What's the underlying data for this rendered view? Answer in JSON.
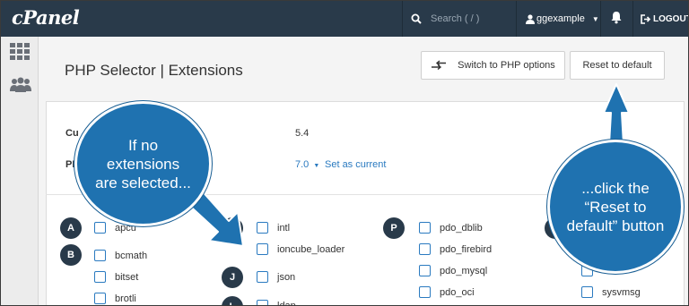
{
  "topbar": {
    "logo": "cPanel",
    "search_placeholder": "Search ( / )",
    "username": "ggexample",
    "logout": "LOGOUT"
  },
  "page": {
    "title": "PHP Selector | Extensions",
    "switch_button": "Switch to PHP options",
    "reset_button": "Reset to default"
  },
  "info": {
    "current_label": "Cu",
    "current_value": "5.4",
    "php_label": "PH",
    "selected_version": "7.0",
    "set_current": "Set as current"
  },
  "groups": {
    "a": "A",
    "b": "B",
    "i": "I",
    "j": "J",
    "l": "L",
    "p": "P"
  },
  "extensions": {
    "col1": [
      "apcu",
      "bcmath",
      "bitset",
      "brotli"
    ],
    "col2": [
      "intl",
      "ioncube_loader",
      "json",
      "ldap"
    ],
    "col3": [
      "pdo_dblib",
      "pdo_firebird",
      "pdo_mysql",
      "pdo_oci"
    ],
    "col4": [
      "sysvmsg"
    ]
  },
  "callouts": {
    "left": "If no extensions are selected...",
    "right": "...click the “Reset to default” button"
  },
  "colors": {
    "topbar": "#293a4a",
    "callout": "#1f72b0",
    "link": "#2a7ac0"
  }
}
